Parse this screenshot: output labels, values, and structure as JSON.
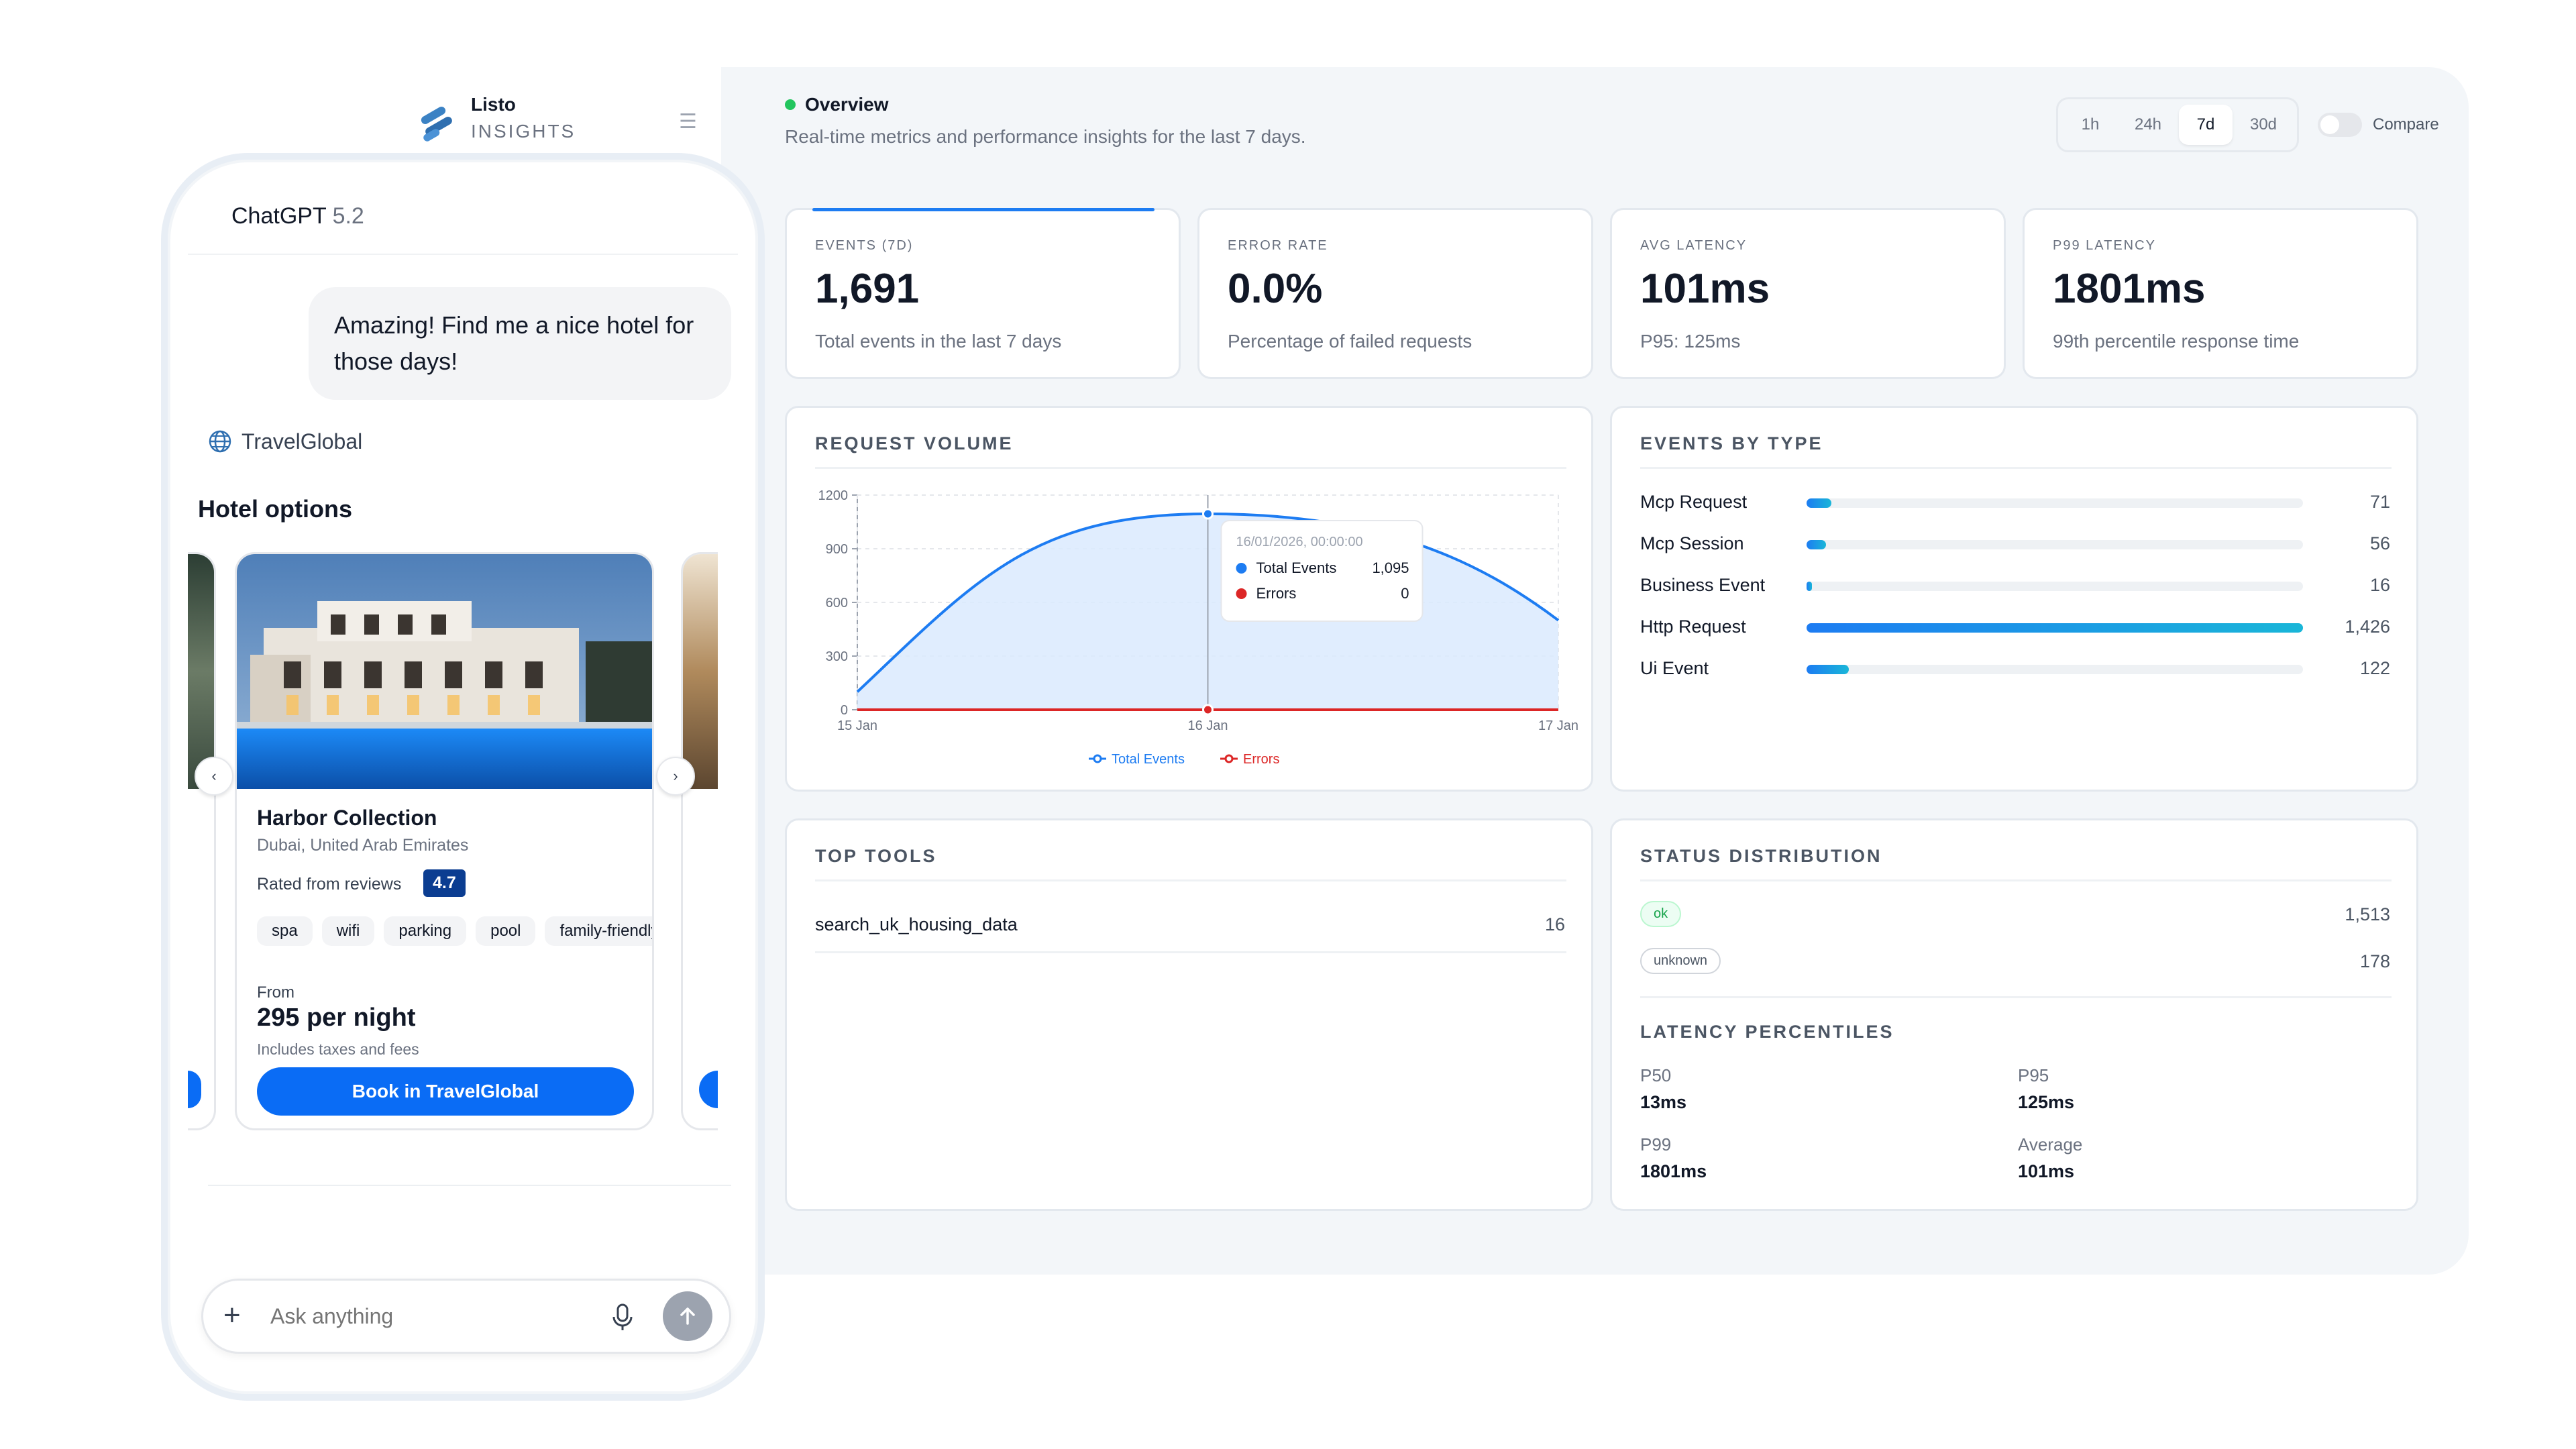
{
  "brand": {
    "name": "Listo",
    "subtitle": "INSIGHTS"
  },
  "overview": {
    "title": "Overview",
    "description": "Real-time metrics and performance insights for the last 7 days.",
    "ranges": [
      "1h",
      "24h",
      "7d",
      "30d"
    ],
    "selected_range": "7d",
    "compare_label": "Compare"
  },
  "stats": [
    {
      "caption": "EVENTS (7D)",
      "value": "1,691",
      "sub": "Total events in the last 7 days"
    },
    {
      "caption": "ERROR RATE",
      "value": "0.0%",
      "sub": "Percentage of failed requests"
    },
    {
      "caption": "AVG LATENCY",
      "value": "101ms",
      "sub": "P95: 125ms"
    },
    {
      "caption": "P99 LATENCY",
      "value": "1801ms",
      "sub": "99th percentile response time"
    }
  ],
  "request_volume": {
    "title": "REQUEST VOLUME"
  },
  "chart_data": {
    "type": "area",
    "title": "REQUEST VOLUME",
    "x_ticks": [
      "15 Jan",
      "16 Jan",
      "17 Jan"
    ],
    "y_ticks": [
      "1200",
      "900",
      "600",
      "300",
      "0"
    ],
    "ylim": [
      0,
      1200
    ],
    "series": [
      {
        "name": "Total Events",
        "color": "#1d7cf2",
        "points": [
          [
            0,
            100
          ],
          [
            0.5,
            1095
          ],
          [
            1,
            500
          ]
        ]
      },
      {
        "name": "Errors",
        "color": "#dc2626",
        "points": [
          [
            0,
            0
          ],
          [
            0.5,
            0
          ],
          [
            1,
            0
          ]
        ]
      }
    ],
    "tooltip": {
      "title": "16/01/2026, 00:00:00",
      "rows": [
        {
          "name": "Total Events",
          "value": "1,095"
        },
        {
          "name": "Errors",
          "value": "0"
        }
      ]
    },
    "legend": [
      "Total Events",
      "Errors"
    ]
  },
  "events_by_type": {
    "title": "EVENTS BY TYPE",
    "max": 1426,
    "rows": [
      {
        "label": "Mcp Request",
        "value": 71,
        "display": "71"
      },
      {
        "label": "Mcp Session",
        "value": 56,
        "display": "56"
      },
      {
        "label": "Business Event",
        "value": 16,
        "display": "16"
      },
      {
        "label": "Http Request",
        "value": 1426,
        "display": "1,426"
      },
      {
        "label": "Ui Event",
        "value": 122,
        "display": "122"
      }
    ]
  },
  "top_tools": {
    "title": "TOP TOOLS",
    "rows": [
      {
        "name": "search_uk_housing_data",
        "count": "16"
      }
    ]
  },
  "status_distribution": {
    "title": "STATUS DISTRIBUTION",
    "rows": [
      {
        "label": "ok",
        "count": "1,513",
        "color": "#16a34a"
      },
      {
        "label": "unknown",
        "count": "178",
        "color": "#6b7280"
      }
    ]
  },
  "latency": {
    "title": "LATENCY PERCENTILES",
    "items": [
      {
        "label": "P50",
        "value": "13ms"
      },
      {
        "label": "P95",
        "value": "125ms"
      },
      {
        "label": "P99",
        "value": "1801ms"
      },
      {
        "label": "Average",
        "value": "101ms"
      }
    ]
  },
  "phone": {
    "app_name": "ChatGPT",
    "version": "5.2",
    "user_message": "Amazing! Find me a nice hotel for those days!",
    "source": "TravelGlobal",
    "section_title": "Hotel options",
    "hotel": {
      "name": "Harbor Collection",
      "location": "Dubai, United Arab Emirates",
      "rated_label": "Rated from reviews",
      "rating": "4.7",
      "tags": [
        "spa",
        "wifi",
        "parking",
        "pool",
        "family-friendly"
      ],
      "from_label": "From",
      "price": "295 per night",
      "price_note": "Includes taxes and fees",
      "book_label": "Book in TravelGlobal"
    },
    "input_placeholder": "Ask anything"
  },
  "colors": {
    "accent": "#1d7cf2",
    "error": "#dc2626",
    "booking": "#0a6cf5",
    "rating_bg": "#0b3d91"
  }
}
